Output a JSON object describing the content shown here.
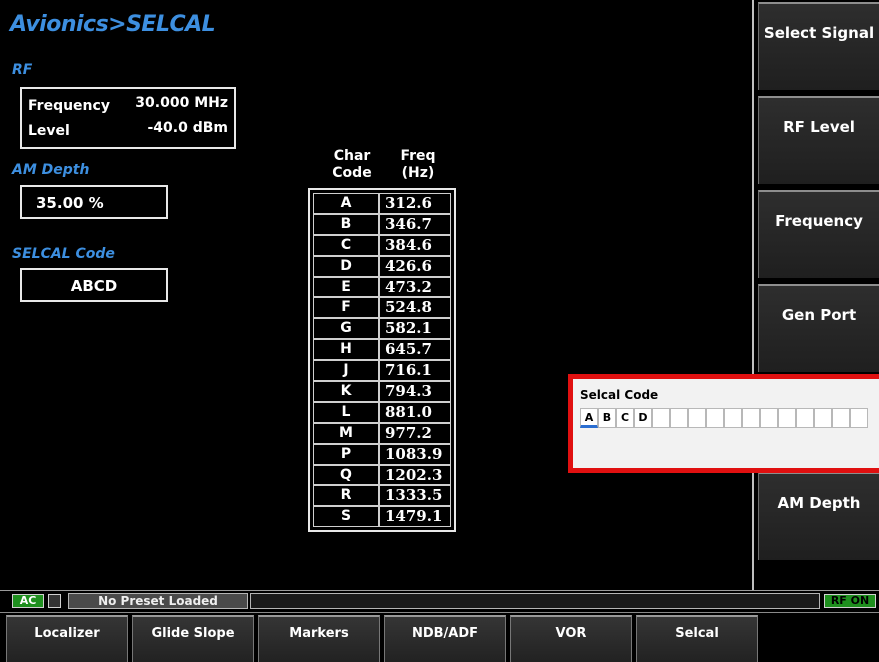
{
  "title": "Avionics>SELCAL",
  "rf": {
    "label": "RF",
    "frequency_label": "Frequency",
    "frequency_value": "30.000 MHz",
    "level_label": "Level",
    "level_value": "-40.0 dBm"
  },
  "am_depth": {
    "label": "AM Depth",
    "value": "35.00 %"
  },
  "selcal_code": {
    "label": "SELCAL Code",
    "value": "ABCD"
  },
  "table": {
    "col1_line1": "Char",
    "col1_line2": "Code",
    "col2_line1": "Freq",
    "col2_line2": "(Hz)",
    "rows": [
      {
        "code": "A",
        "freq": "312.6"
      },
      {
        "code": "B",
        "freq": "346.7"
      },
      {
        "code": "C",
        "freq": "384.6"
      },
      {
        "code": "D",
        "freq": "426.6"
      },
      {
        "code": "E",
        "freq": "473.2"
      },
      {
        "code": "F",
        "freq": "524.8"
      },
      {
        "code": "G",
        "freq": "582.1"
      },
      {
        "code": "H",
        "freq": "645.7"
      },
      {
        "code": "J",
        "freq": "716.1"
      },
      {
        "code": "K",
        "freq": "794.3"
      },
      {
        "code": "L",
        "freq": "881.0"
      },
      {
        "code": "M",
        "freq": "977.2"
      },
      {
        "code": "P",
        "freq": "1083.9"
      },
      {
        "code": "Q",
        "freq": "1202.3"
      },
      {
        "code": "R",
        "freq": "1333.5"
      },
      {
        "code": "S",
        "freq": "1479.1"
      }
    ]
  },
  "softkeys": [
    "Select Signal",
    "RF Level",
    "Frequency",
    "Gen Port",
    "",
    "AM Depth"
  ],
  "popup": {
    "title": "Selcal Code",
    "cells": [
      "A",
      "B",
      "C",
      "D",
      "",
      "",
      "",
      "",
      "",
      "",
      "",
      "",
      "",
      "",
      "",
      ""
    ]
  },
  "status": {
    "ac": "AC",
    "preset": "No Preset Loaded",
    "rf_on": "RF ON"
  },
  "tabs": [
    "Localizer",
    "Glide Slope",
    "Markers",
    "NDB/ADF",
    "VOR",
    "Selcal"
  ],
  "colors": {
    "accent_blue": "#3d8fe0",
    "popup_border": "#e01010",
    "status_green": "#1e8f1e"
  }
}
